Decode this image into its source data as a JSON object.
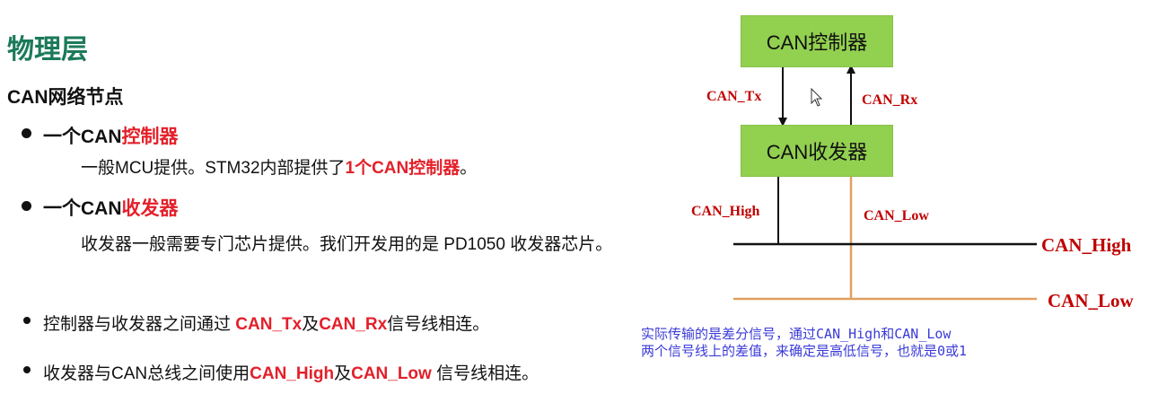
{
  "page": {
    "title": "物理层",
    "subtitle": "CAN网络节点"
  },
  "items": [
    {
      "prefix": "一个CAN",
      "highlight": "控制器",
      "desc_prefix": "一般MCU提供。STM32内部提供了",
      "desc_highlight": "1个CAN控制器",
      "desc_suffix": "。"
    },
    {
      "prefix": "一个CAN",
      "highlight": "收发器",
      "desc_prefix": "收发器一般需要专门芯片提供。我们开发用的是 PD1050 收发器芯片。"
    }
  ],
  "notes": [
    {
      "p1": "控制器与收发器之间通过 ",
      "h1": "CAN_Tx",
      "p2": "及",
      "h2": "CAN_Rx",
      "p3": "信号线相连。"
    },
    {
      "p1": "收发器与CAN总线之间使用",
      "h1": "CAN_High",
      "p2": "及",
      "h2": "CAN_Low",
      "p3": " 信号线相连。"
    }
  ],
  "diagram": {
    "controller_label": "CAN控制器",
    "transceiver_label": "CAN收发器",
    "tx_label": "CAN_Tx",
    "rx_label": "CAN_Rx",
    "high_wire_label": "CAN_High",
    "low_wire_label": "CAN_Low",
    "bus_high_label": "CAN_High",
    "bus_low_label": "CAN_Low",
    "note_line1": "实际传输的是差分信号，通过CAN_High和CAN_Low",
    "note_line2": "两个信号线上的差值，来确定是高低信号，也就是0或1"
  },
  "colors": {
    "title": "#1b7a5a",
    "highlight": "#e3202a",
    "box_fill": "#92d050",
    "diagram_label": "#c00000",
    "bus_high": "#111111",
    "bus_low": "#e0a060",
    "note": "#3a3ad8"
  },
  "icons": {
    "cursor": "mouse-pointer-icon"
  }
}
